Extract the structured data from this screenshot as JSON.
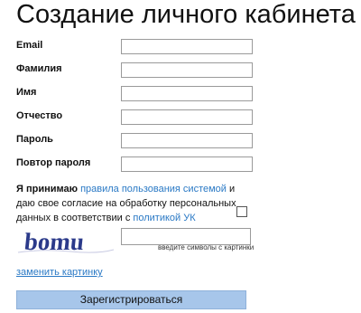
{
  "page": {
    "title": "Создание личного кабинета"
  },
  "form": {
    "fields": [
      {
        "label": "Email",
        "value": ""
      },
      {
        "label": "Фамилия",
        "value": ""
      },
      {
        "label": "Имя",
        "value": ""
      },
      {
        "label": "Отчество",
        "value": ""
      },
      {
        "label": "Пароль",
        "value": ""
      },
      {
        "label": "Повтор пароля",
        "value": ""
      }
    ],
    "agreement": {
      "prefix": "Я принимаю",
      "rules_link": "правила пользования системой",
      "middle": "и даю свое согласие на обработку персональных данных в соответствии с",
      "policy_link": "политикой УК",
      "checked": false
    },
    "captcha": {
      "text": "bomu",
      "text_color": "#2b3a8a",
      "input_value": "",
      "hint": "введите символы с картинки",
      "change_link": "заменить картинку"
    },
    "submit_label": "Зарегистрироваться"
  },
  "colors": {
    "link": "#2a79c5",
    "button": "#a7c6ea"
  }
}
